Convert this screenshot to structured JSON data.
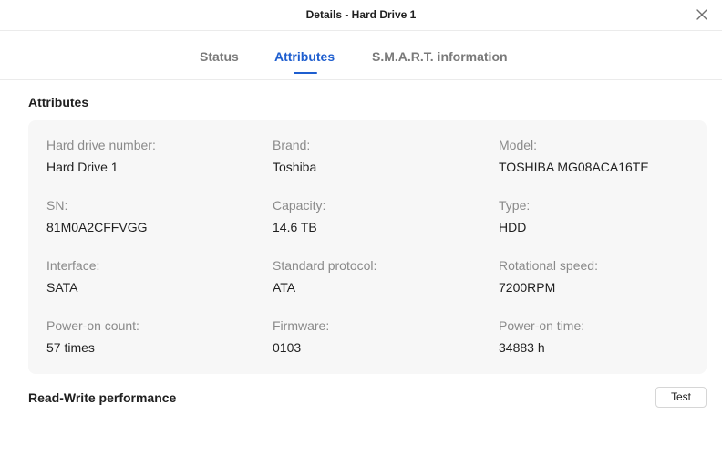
{
  "dialog": {
    "title": "Details - Hard Drive 1",
    "close_icon": "close-icon"
  },
  "tabs": [
    {
      "label": "Status",
      "active": false
    },
    {
      "label": "Attributes",
      "active": true
    },
    {
      "label": "S.M.A.R.T. information",
      "active": false
    }
  ],
  "attributes": {
    "title": "Attributes",
    "items": [
      {
        "label": "Hard drive number:",
        "value": "Hard Drive 1"
      },
      {
        "label": "Brand:",
        "value": "Toshiba"
      },
      {
        "label": "Model:",
        "value": "TOSHIBA MG08ACA16TE"
      },
      {
        "label": "SN:",
        "value": "81M0A2CFFVGG"
      },
      {
        "label": "Capacity:",
        "value": "14.6 TB"
      },
      {
        "label": "Type:",
        "value": "HDD"
      },
      {
        "label": "Interface:",
        "value": "SATA"
      },
      {
        "label": "Standard protocol:",
        "value": "ATA"
      },
      {
        "label": "Rotational speed:",
        "value": "7200RPM"
      },
      {
        "label": "Power-on count:",
        "value": "57 times"
      },
      {
        "label": "Firmware:",
        "value": "0103"
      },
      {
        "label": "Power-on time:",
        "value": "34883 h"
      }
    ]
  },
  "performance": {
    "title": "Read-Write performance",
    "test_label": "Test"
  },
  "colors": {
    "accent": "#1e5ecf",
    "panel_bg": "#f7f7f7",
    "label_gray": "#8a8a8a"
  }
}
